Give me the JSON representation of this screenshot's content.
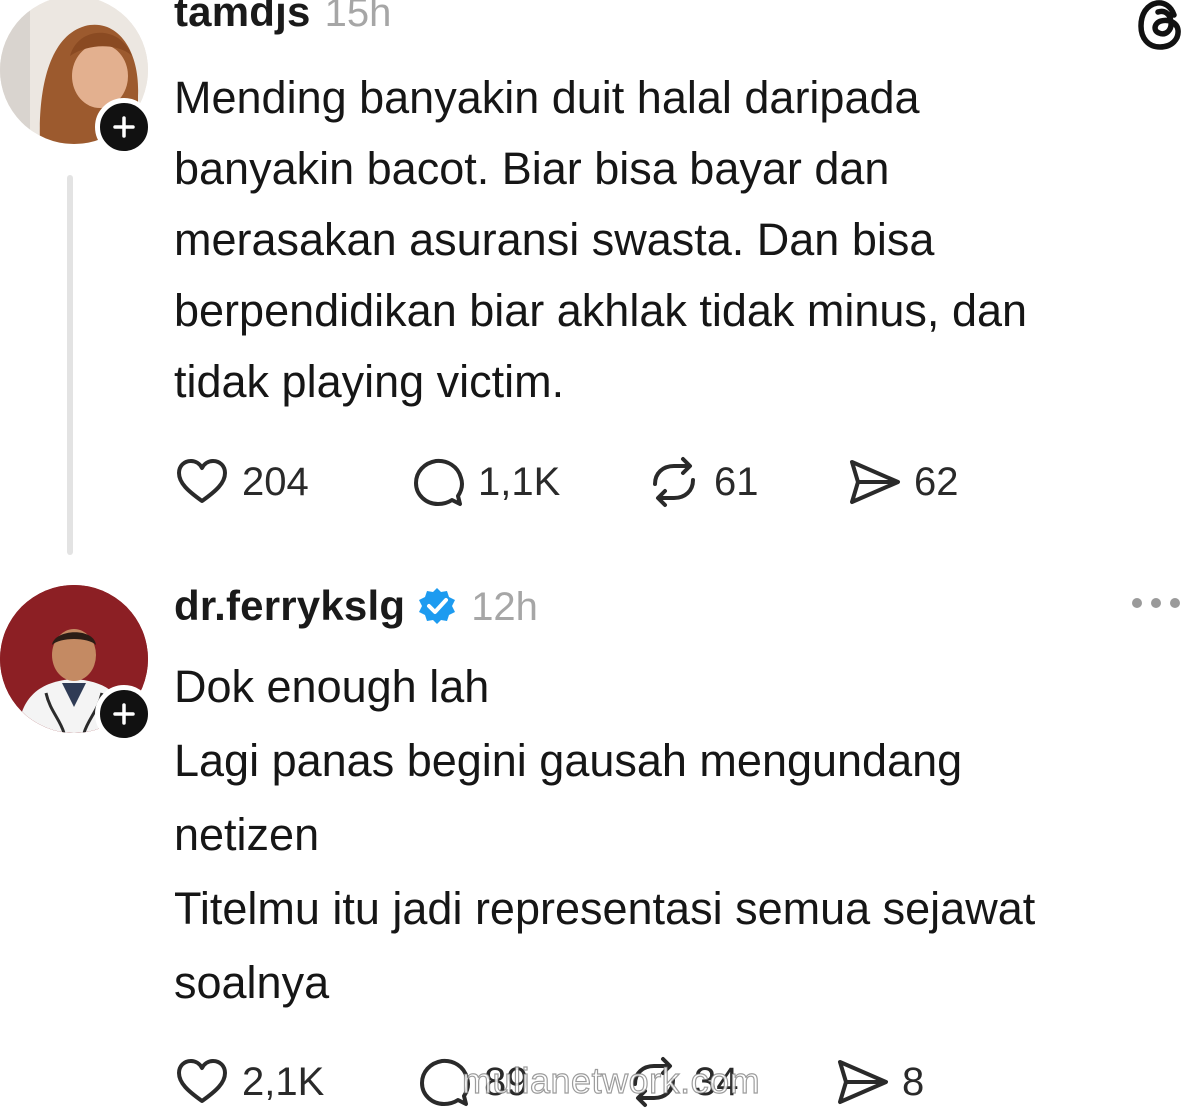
{
  "posts": [
    {
      "username": "tamdjs",
      "time": "15h",
      "verified": false,
      "text": [
        "Mending banyakin duit halal daripada",
        "banyakin bacot. Biar bisa bayar dan",
        "merasakan asuransi swasta. Dan bisa",
        "berpendidikan biar akhlak tidak minus, dan",
        "tidak playing victim."
      ],
      "likes": "204",
      "replies": "1,1K",
      "reposts": "61",
      "shares": "62"
    },
    {
      "username": "dr.ferrykslg",
      "time": "12h",
      "verified": true,
      "text": [
        "Dok enough lah",
        "Lagi panas begini gausah mengundang",
        "netizen",
        "Titelmu itu jadi representasi semua sejawat",
        "soalnya"
      ],
      "likes": "2,1K",
      "replies": "89",
      "reposts": "34",
      "shares": "8"
    }
  ],
  "watermark": "mulianetwork.com",
  "colors": {
    "verified_blue": "#1d9bf0",
    "muted_gray": "#a6a6a6",
    "text": "#161616"
  }
}
